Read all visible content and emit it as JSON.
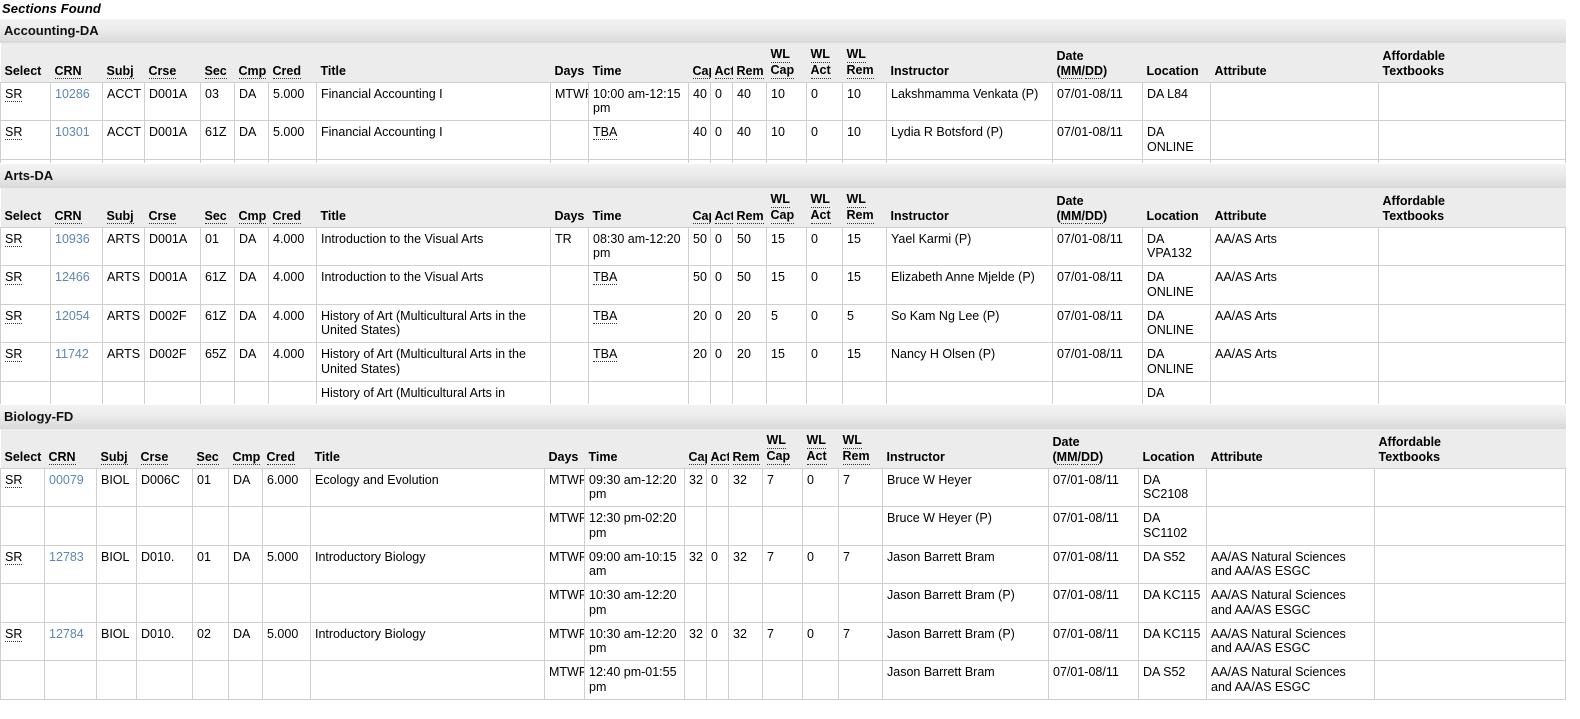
{
  "page": {
    "title": "Sections Found"
  },
  "columns": [
    {
      "key": "select",
      "label": "Select",
      "abbr": false
    },
    {
      "key": "crn",
      "label": "CRN",
      "abbr": true
    },
    {
      "key": "subj",
      "label": "Subj",
      "abbr": true
    },
    {
      "key": "crse",
      "label": "Crse",
      "abbr": true
    },
    {
      "key": "sec",
      "label": "Sec",
      "abbr": true
    },
    {
      "key": "cmp",
      "label": "Cmp",
      "abbr": true
    },
    {
      "key": "cred",
      "label": "Cred",
      "abbr": true
    },
    {
      "key": "title",
      "label": "Title",
      "abbr": false
    },
    {
      "key": "days",
      "label": "Days",
      "abbr": false
    },
    {
      "key": "time",
      "label": "Time",
      "abbr": false
    },
    {
      "key": "cap",
      "label": "Cap",
      "abbr": true
    },
    {
      "key": "act",
      "label": "Act",
      "abbr": true
    },
    {
      "key": "rem",
      "label": "Rem",
      "abbr": true
    },
    {
      "key": "wlcap",
      "label": "WL Cap",
      "abbr": true
    },
    {
      "key": "wlact",
      "label": "WL Act",
      "abbr": true
    },
    {
      "key": "wlrem",
      "label": "WL Rem",
      "abbr": true
    },
    {
      "key": "instructor",
      "label": "Instructor",
      "abbr": false
    },
    {
      "key": "date",
      "label": "Date (MM/DD)",
      "abbr": true
    },
    {
      "key": "location",
      "label": "Location",
      "abbr": false
    },
    {
      "key": "attribute",
      "label": "Attribute",
      "abbr": false
    },
    {
      "key": "textbooks",
      "label": "Affordable Textbooks",
      "abbr": false
    }
  ],
  "header_labels": {
    "select": "Select",
    "crn": "CRN",
    "subj": "Subj",
    "crse": "Crse",
    "sec": "Sec",
    "cmp": "Cmp",
    "cred": "Cred",
    "title": "Title",
    "days": "Days",
    "time": "Time",
    "cap": "Cap",
    "act": "Act",
    "rem": "Rem",
    "wl": "WL",
    "wl_cap": "Cap",
    "wl_act": "Act",
    "wl_rem": "Rem",
    "instructor": "Instructor",
    "date": "Date",
    "date_fmt_open": "(",
    "date_mm": "MM",
    "date_slash": "/",
    "date_dd": "DD",
    "date_fmt_close": ")",
    "location": "Location",
    "attribute": "Attribute",
    "textbooks_l1": "Affordable",
    "textbooks_l2": "Textbooks"
  },
  "select_label": "SR",
  "tba_label": "TBA",
  "colors": {
    "link": "#5c87b2",
    "header_bg": "#ececec",
    "section_bar_top": "#f3f3f3",
    "section_bar_bottom": "#d9d9d9",
    "border": "#cfcfcf",
    "text": "#000000"
  },
  "sections": [
    {
      "id": "accounting-da",
      "name": "Accounting-DA",
      "rows": [
        {
          "select": "SR",
          "crn": "10286",
          "subj": "ACCT",
          "crse": "D001A",
          "sec": "03",
          "cmp": "DA",
          "cred": "5.000",
          "title": "Financial Accounting I",
          "days": "MTWR",
          "time": "10:00 am-12:15 pm",
          "time_tba": false,
          "cap": "40",
          "act": "0",
          "rem": "40",
          "wlcap": "10",
          "wlact": "0",
          "wlrem": "10",
          "instructor": "Lakshmamma Venkata (P)",
          "date": "07/01-08/11",
          "location": "DA L84",
          "attribute": "",
          "textbooks": ""
        },
        {
          "select": "SR",
          "crn": "10301",
          "subj": "ACCT",
          "crse": "D001A",
          "sec": "61Z",
          "cmp": "DA",
          "cred": "5.000",
          "title": "Financial Accounting I",
          "days": "",
          "time": "TBA",
          "time_tba": true,
          "cap": "40",
          "act": "0",
          "rem": "40",
          "wlcap": "10",
          "wlact": "0",
          "wlrem": "10",
          "instructor": "Lydia R Botsford (P)",
          "date": "07/01-08/11",
          "location": "DA ONLINE",
          "attribute": "",
          "textbooks": ""
        }
      ],
      "clipped_row": true
    },
    {
      "id": "arts-da",
      "name": "Arts-DA",
      "rows": [
        {
          "select": "SR",
          "crn": "10936",
          "subj": "ARTS",
          "crse": "D001A",
          "sec": "01",
          "cmp": "DA",
          "cred": "4.000",
          "title": "Introduction to the Visual Arts",
          "days": "TR",
          "time": "08:30 am-12:20 pm",
          "time_tba": false,
          "cap": "50",
          "act": "0",
          "rem": "50",
          "wlcap": "15",
          "wlact": "0",
          "wlrem": "15",
          "instructor": "Yael Karmi (P)",
          "date": "07/01-08/11",
          "location": "DA VPA132",
          "attribute": "AA/AS Arts",
          "textbooks": ""
        },
        {
          "select": "SR",
          "crn": "12466",
          "subj": "ARTS",
          "crse": "D001A",
          "sec": "61Z",
          "cmp": "DA",
          "cred": "4.000",
          "title": "Introduction to the Visual Arts",
          "days": "",
          "time": "TBA",
          "time_tba": true,
          "cap": "50",
          "act": "0",
          "rem": "50",
          "wlcap": "15",
          "wlact": "0",
          "wlrem": "15",
          "instructor": "Elizabeth Anne Mjelde (P)",
          "date": "07/01-08/11",
          "location": "DA ONLINE",
          "attribute": "AA/AS Arts",
          "textbooks": ""
        },
        {
          "select": "SR",
          "crn": "12054",
          "subj": "ARTS",
          "crse": "D002F",
          "sec": "61Z",
          "cmp": "DA",
          "cred": "4.000",
          "title": "History of Art (Multicultural Arts in the United States)",
          "days": "",
          "time": "TBA",
          "time_tba": true,
          "cap": "20",
          "act": "0",
          "rem": "20",
          "wlcap": "5",
          "wlact": "0",
          "wlrem": "5",
          "instructor": "So Kam Ng Lee (P)",
          "date": "07/01-08/11",
          "location": "DA ONLINE",
          "attribute": "AA/AS Arts",
          "textbooks": ""
        },
        {
          "select": "SR",
          "crn": "11742",
          "subj": "ARTS",
          "crse": "D002F",
          "sec": "65Z",
          "cmp": "DA",
          "cred": "4.000",
          "title": "History of Art (Multicultural Arts in the United States)",
          "days": "",
          "time": "TBA",
          "time_tba": true,
          "cap": "20",
          "act": "0",
          "rem": "20",
          "wlcap": "15",
          "wlact": "0",
          "wlrem": "15",
          "instructor": "Nancy H Olsen (P)",
          "date": "07/01-08/11",
          "location": "DA ONLINE",
          "attribute": "AA/AS Arts",
          "textbooks": ""
        }
      ],
      "clipped_row": true,
      "clipped_title": "History of Art (Multicultural Arts in",
      "clipped_location": "DA"
    },
    {
      "id": "biology-fd",
      "name": "Biology-FD",
      "rows": [
        {
          "select": "SR",
          "crn": "00079",
          "subj": "BIOL",
          "crse": "D006C",
          "sec": "01",
          "cmp": "DA",
          "cred": "6.000",
          "title": "Ecology and Evolution",
          "days": "MTWR",
          "time": "09:30 am-12:20 pm",
          "time_tba": false,
          "cap": "32",
          "act": "0",
          "rem": "32",
          "wlcap": "7",
          "wlact": "0",
          "wlrem": "7",
          "instructor": "Bruce W Heyer",
          "date": "07/01-08/11",
          "location": "DA SC2108",
          "attribute": "",
          "textbooks": ""
        },
        {
          "select": "",
          "crn": "",
          "subj": "",
          "crse": "",
          "sec": "",
          "cmp": "",
          "cred": "",
          "title": "",
          "days": "MTWR",
          "time": "12:30 pm-02:20 pm",
          "time_tba": false,
          "cap": "",
          "act": "",
          "rem": "",
          "wlcap": "",
          "wlact": "",
          "wlrem": "",
          "instructor": "Bruce W Heyer (P)",
          "date": "07/01-08/11",
          "location": "DA SC1102",
          "attribute": "",
          "textbooks": ""
        },
        {
          "select": "SR",
          "crn": "12783",
          "subj": "BIOL",
          "crse": "D010.",
          "sec": "01",
          "cmp": "DA",
          "cred": "5.000",
          "title": "Introductory Biology",
          "days": "MTWR",
          "time": "09:00 am-10:15 am",
          "time_tba": false,
          "cap": "32",
          "act": "0",
          "rem": "32",
          "wlcap": "7",
          "wlact": "0",
          "wlrem": "7",
          "instructor": "Jason Barrett Bram",
          "date": "07/01-08/11",
          "location": "DA S52",
          "attribute": "AA/AS Natural Sciences and AA/AS ESGC",
          "textbooks": ""
        },
        {
          "select": "",
          "crn": "",
          "subj": "",
          "crse": "",
          "sec": "",
          "cmp": "",
          "cred": "",
          "title": "",
          "days": "MTWR",
          "time": "10:30 am-12:20 pm",
          "time_tba": false,
          "cap": "",
          "act": "",
          "rem": "",
          "wlcap": "",
          "wlact": "",
          "wlrem": "",
          "instructor": "Jason Barrett Bram (P)",
          "date": "07/01-08/11",
          "location": "DA KC115",
          "attribute": "AA/AS Natural Sciences and AA/AS ESGC",
          "textbooks": ""
        },
        {
          "select": "SR",
          "crn": "12784",
          "subj": "BIOL",
          "crse": "D010.",
          "sec": "02",
          "cmp": "DA",
          "cred": "5.000",
          "title": "Introductory Biology",
          "days": "MTWR",
          "time": "10:30 am-12:20 pm",
          "time_tba": false,
          "cap": "32",
          "act": "0",
          "rem": "32",
          "wlcap": "7",
          "wlact": "0",
          "wlrem": "7",
          "instructor": "Jason Barrett Bram (P)",
          "date": "07/01-08/11",
          "location": "DA KC115",
          "attribute": "AA/AS Natural Sciences and AA/AS ESGC",
          "textbooks": ""
        },
        {
          "select": "",
          "crn": "",
          "subj": "",
          "crse": "",
          "sec": "",
          "cmp": "",
          "cred": "",
          "title": "",
          "days": "MTWR",
          "time": "12:40 pm-01:55 pm",
          "time_tba": false,
          "cap": "",
          "act": "",
          "rem": "",
          "wlcap": "",
          "wlact": "",
          "wlrem": "",
          "instructor": "Jason Barrett Bram",
          "date": "07/01-08/11",
          "location": "DA S52",
          "attribute": "AA/AS Natural Sciences and AA/AS ESGC",
          "textbooks": ""
        }
      ],
      "clipped_row": false
    }
  ]
}
